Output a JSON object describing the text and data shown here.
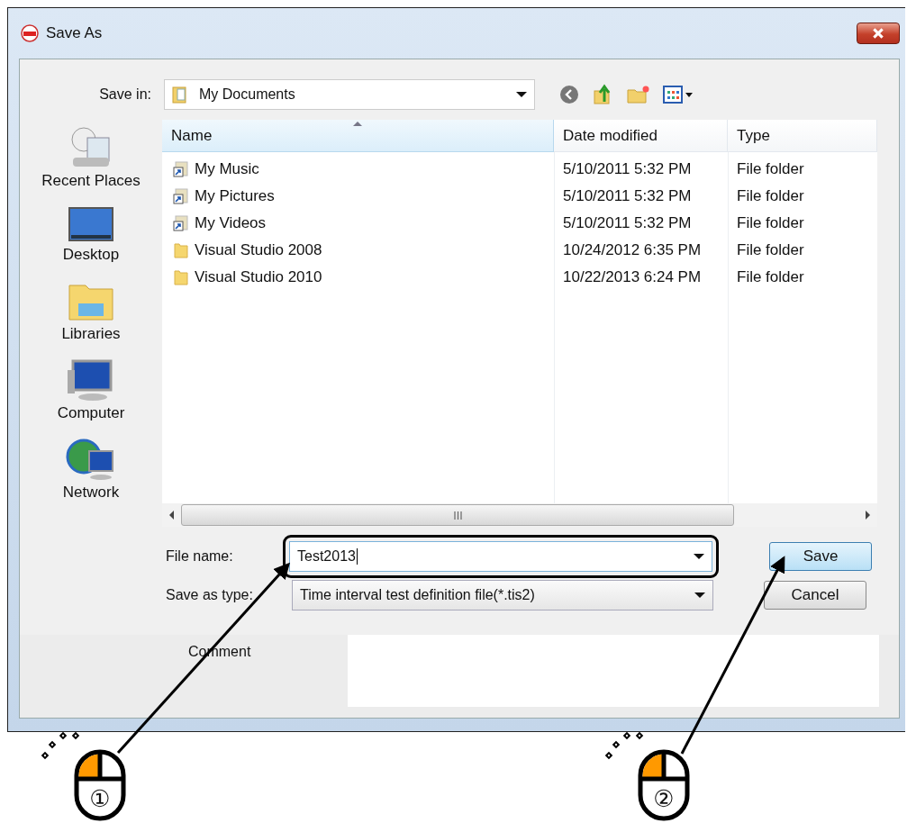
{
  "window": {
    "title": "Save As"
  },
  "save_in": {
    "label": "Save in:",
    "value": "My Documents"
  },
  "places": [
    {
      "label": "Recent Places",
      "kind": "recent"
    },
    {
      "label": "Desktop",
      "kind": "desktop"
    },
    {
      "label": "Libraries",
      "kind": "libraries"
    },
    {
      "label": "Computer",
      "kind": "computer"
    },
    {
      "label": "Network",
      "kind": "network"
    }
  ],
  "table": {
    "columns": [
      {
        "label": "Name",
        "sorted": true
      },
      {
        "label": "Date modified",
        "sorted": false
      },
      {
        "label": "Type",
        "sorted": false
      }
    ],
    "rows": [
      {
        "kind": "shortcut",
        "name": "My Music",
        "date": "5/10/2011 5:32 PM",
        "type": "File folder"
      },
      {
        "kind": "shortcut",
        "name": "My Pictures",
        "date": "5/10/2011 5:32 PM",
        "type": "File folder"
      },
      {
        "kind": "shortcut",
        "name": "My Videos",
        "date": "5/10/2011 5:32 PM",
        "type": "File folder"
      },
      {
        "kind": "folder",
        "name": "Visual Studio 2008",
        "date": "10/24/2012 6:35 PM",
        "type": "File folder"
      },
      {
        "kind": "folder",
        "name": "Visual Studio 2010",
        "date": "10/22/2013 6:24 PM",
        "type": "File folder"
      }
    ]
  },
  "file_name": {
    "label": "File name:",
    "value": "Test2013",
    "highlighted": true
  },
  "save_as_type": {
    "label": "Save as type:",
    "value": "Time interval test definition file(*.tis2)"
  },
  "buttons": [
    {
      "label": "Save",
      "default": true
    },
    {
      "label": "Cancel",
      "default": false
    }
  ],
  "comment": {
    "label": "Comment"
  },
  "callouts": [
    {
      "number": "①"
    },
    {
      "number": "②"
    }
  ]
}
